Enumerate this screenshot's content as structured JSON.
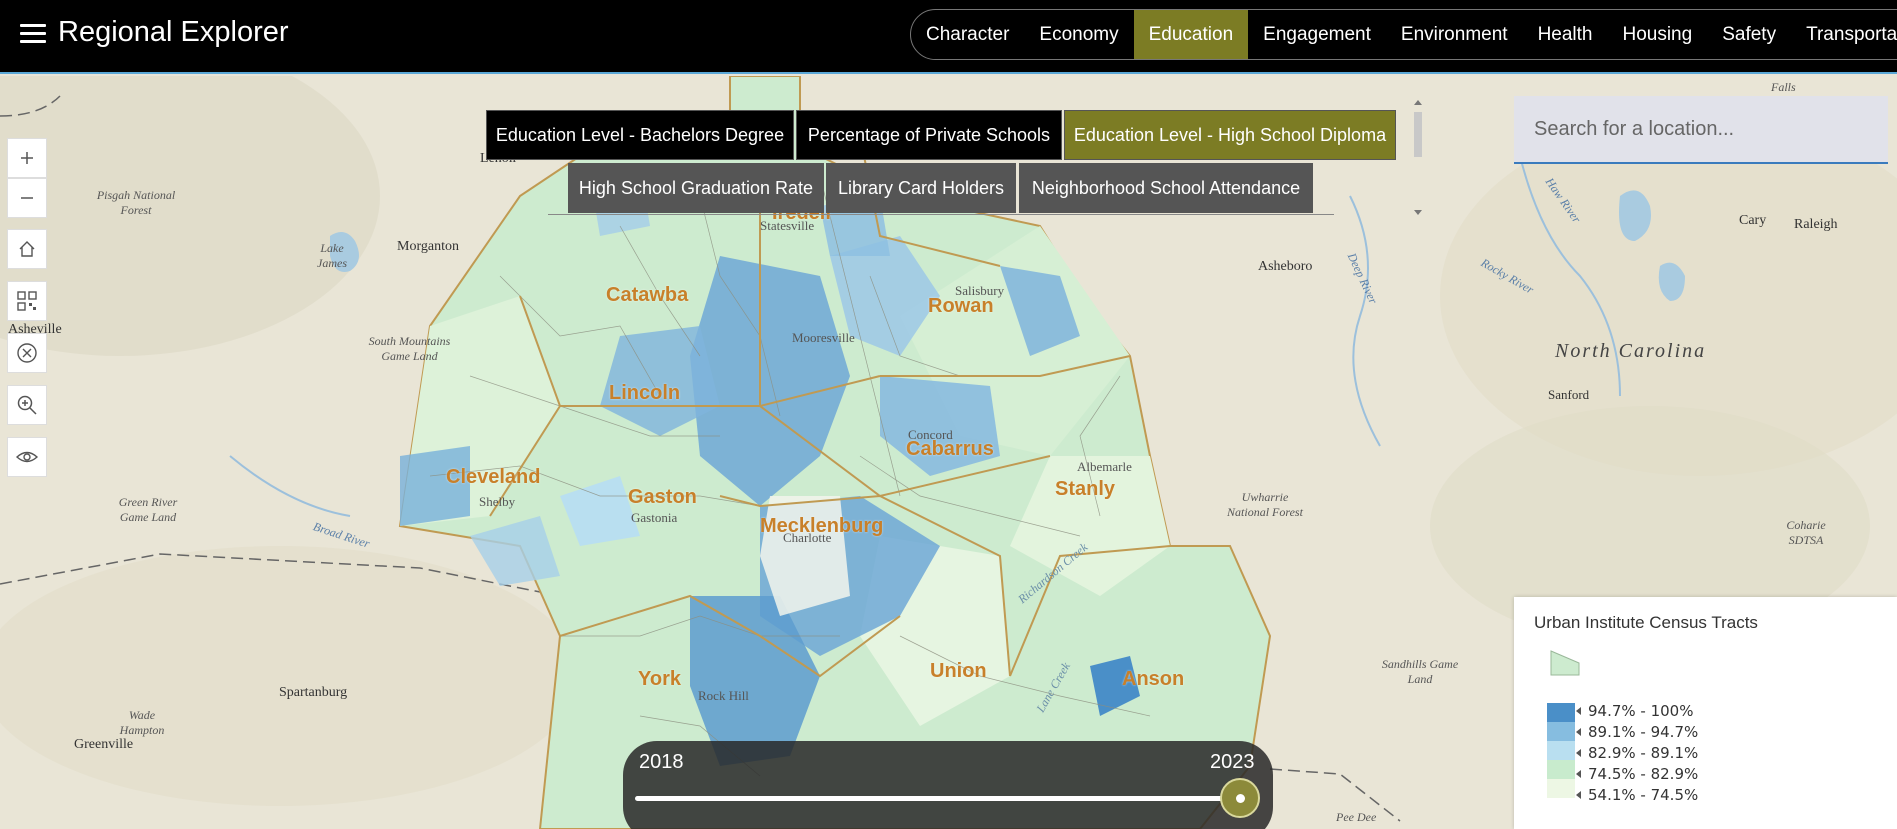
{
  "app": {
    "title": "Regional Explorer"
  },
  "topnav": {
    "items": [
      {
        "label": "Character",
        "active": false
      },
      {
        "label": "Economy",
        "active": false
      },
      {
        "label": "Education",
        "active": true
      },
      {
        "label": "Engagement",
        "active": false
      },
      {
        "label": "Environment",
        "active": false
      },
      {
        "label": "Health",
        "active": false
      },
      {
        "label": "Housing",
        "active": false
      },
      {
        "label": "Safety",
        "active": false
      },
      {
        "label": "Transportation",
        "active": false
      }
    ]
  },
  "layers": {
    "row1": [
      {
        "label": "Education Level - Bachelors Degree",
        "state": "dark"
      },
      {
        "label": "Percentage of Private Schools",
        "state": "dark"
      },
      {
        "label": "Education Level - High School Diploma",
        "state": "active"
      }
    ],
    "row2": [
      {
        "label": "High School Graduation Rate",
        "state": "grey"
      },
      {
        "label": "Library Card Holders",
        "state": "grey"
      },
      {
        "label": "Neighborhood School Attendance",
        "state": "grey"
      }
    ]
  },
  "search": {
    "placeholder": "Search for a location..."
  },
  "legend": {
    "title": "Urban Institute Census Tracts",
    "classes": [
      {
        "label": "94.7% - 100%",
        "color": "#4a8fc8"
      },
      {
        "label": "89.1% - 94.7%",
        "color": "#86bde0"
      },
      {
        "label": "82.9% - 89.1%",
        "color": "#b9dff0"
      },
      {
        "label": "74.5% - 82.9%",
        "color": "#c8ebcd"
      },
      {
        "label": "54.1% - 74.5%",
        "color": "#edf7e4"
      }
    ]
  },
  "timeline": {
    "start": "2018",
    "end": "2023",
    "selected": "2023"
  },
  "map": {
    "counties": [
      "Iredell",
      "Catawba",
      "Rowan",
      "Lincoln",
      "Cabarrus",
      "Cleveland",
      "Gaston",
      "Stanly",
      "Mecklenburg",
      "York",
      "Union",
      "Anson"
    ],
    "places": [
      "Lenoir",
      "Morganton",
      "Asheville",
      "Statesville",
      "Salisbury",
      "Mooresville",
      "Concord",
      "Albemarle",
      "Shelby",
      "Gastonia",
      "Charlotte",
      "Rock Hill",
      "Spartanburg",
      "Greenville",
      "Asheboro",
      "Cary",
      "Raleigh",
      "Sanford",
      "Falls",
      "Pee Dee"
    ],
    "state_label": "North Carolina",
    "features": [
      "Pisgah National Forest",
      "Lake James",
      "South Mountains Game Land",
      "Green River Game Land",
      "Uwharrie National Forest",
      "Sandhills Game Land",
      "Coharie SDTSA",
      "Wade Hampton"
    ],
    "rivers": [
      "Broad River",
      "Deep River",
      "Haw River",
      "Rocky River",
      "Richardson Creek",
      "Lane Creek"
    ]
  },
  "toolbar": {
    "tools": [
      "zoom-in",
      "zoom-out",
      "home",
      "qr",
      "clear",
      "zoom-select",
      "visibility"
    ]
  }
}
